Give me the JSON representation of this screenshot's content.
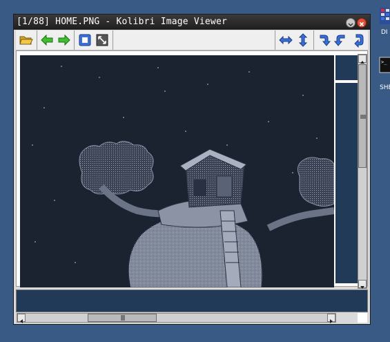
{
  "window": {
    "title": "[1/88] HOME.PNG - Kolibri Image Viewer"
  },
  "desktop": {
    "icons": [
      {
        "label": "DI"
      },
      {
        "label": "SHE"
      }
    ]
  },
  "toolbar": {
    "buttons": [
      {
        "name": "open-folder",
        "icon": "folder-open-icon"
      },
      {
        "name": "previous",
        "icon": "arrow-left-icon"
      },
      {
        "name": "next",
        "icon": "arrow-right-icon"
      },
      {
        "name": "fit-window",
        "icon": "fit-icon"
      },
      {
        "name": "fullscreen",
        "icon": "expand-icon"
      },
      {
        "name": "flip-horizontal",
        "icon": "flip-horizontal-icon"
      },
      {
        "name": "flip-vertical",
        "icon": "flip-vertical-icon"
      },
      {
        "name": "rotate-cw",
        "icon": "rotate-cw-icon"
      },
      {
        "name": "rotate-ccw",
        "icon": "rotate-ccw-icon"
      },
      {
        "name": "rotate-180",
        "icon": "rotate-180-icon"
      }
    ]
  },
  "colors": {
    "accent_green": "#3fbf2e",
    "accent_blue": "#3a6fd8",
    "image_bg": "#1b2230",
    "panel_bg": "#213a58"
  }
}
